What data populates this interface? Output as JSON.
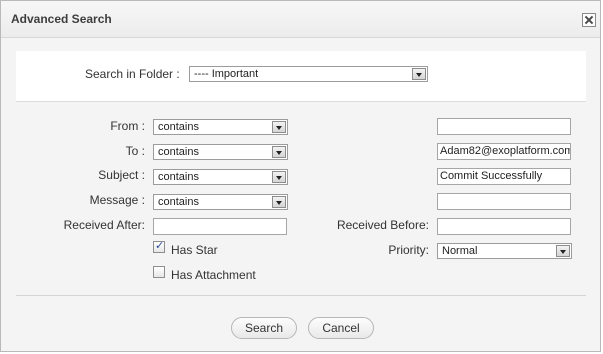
{
  "dialog": {
    "title": "Advanced Search"
  },
  "folder": {
    "label": "Search in Folder :",
    "value": "---- Important"
  },
  "rows": {
    "from": {
      "label": "From :",
      "condition": "contains",
      "value": ""
    },
    "to": {
      "label": "To :",
      "condition": "contains",
      "value": "Adam82@exoplatform.com"
    },
    "subject": {
      "label": "Subject :",
      "condition": "contains",
      "value": "Commit Successfully"
    },
    "message": {
      "label": "Message :",
      "condition": "contains",
      "value": ""
    }
  },
  "received_after": {
    "label": "Received After:",
    "value": ""
  },
  "received_before": {
    "label": "Received Before:",
    "value": ""
  },
  "has_star": {
    "label": "Has Star",
    "checked": true
  },
  "has_attachment": {
    "label": "Has Attachment",
    "checked": false
  },
  "priority": {
    "label": "Priority:",
    "value": "Normal"
  },
  "buttons": {
    "search": "Search",
    "cancel": "Cancel"
  },
  "icons": {
    "close": "close-icon",
    "dropdown": "chevron-down-icon",
    "checkmark": "checkmark-icon"
  }
}
